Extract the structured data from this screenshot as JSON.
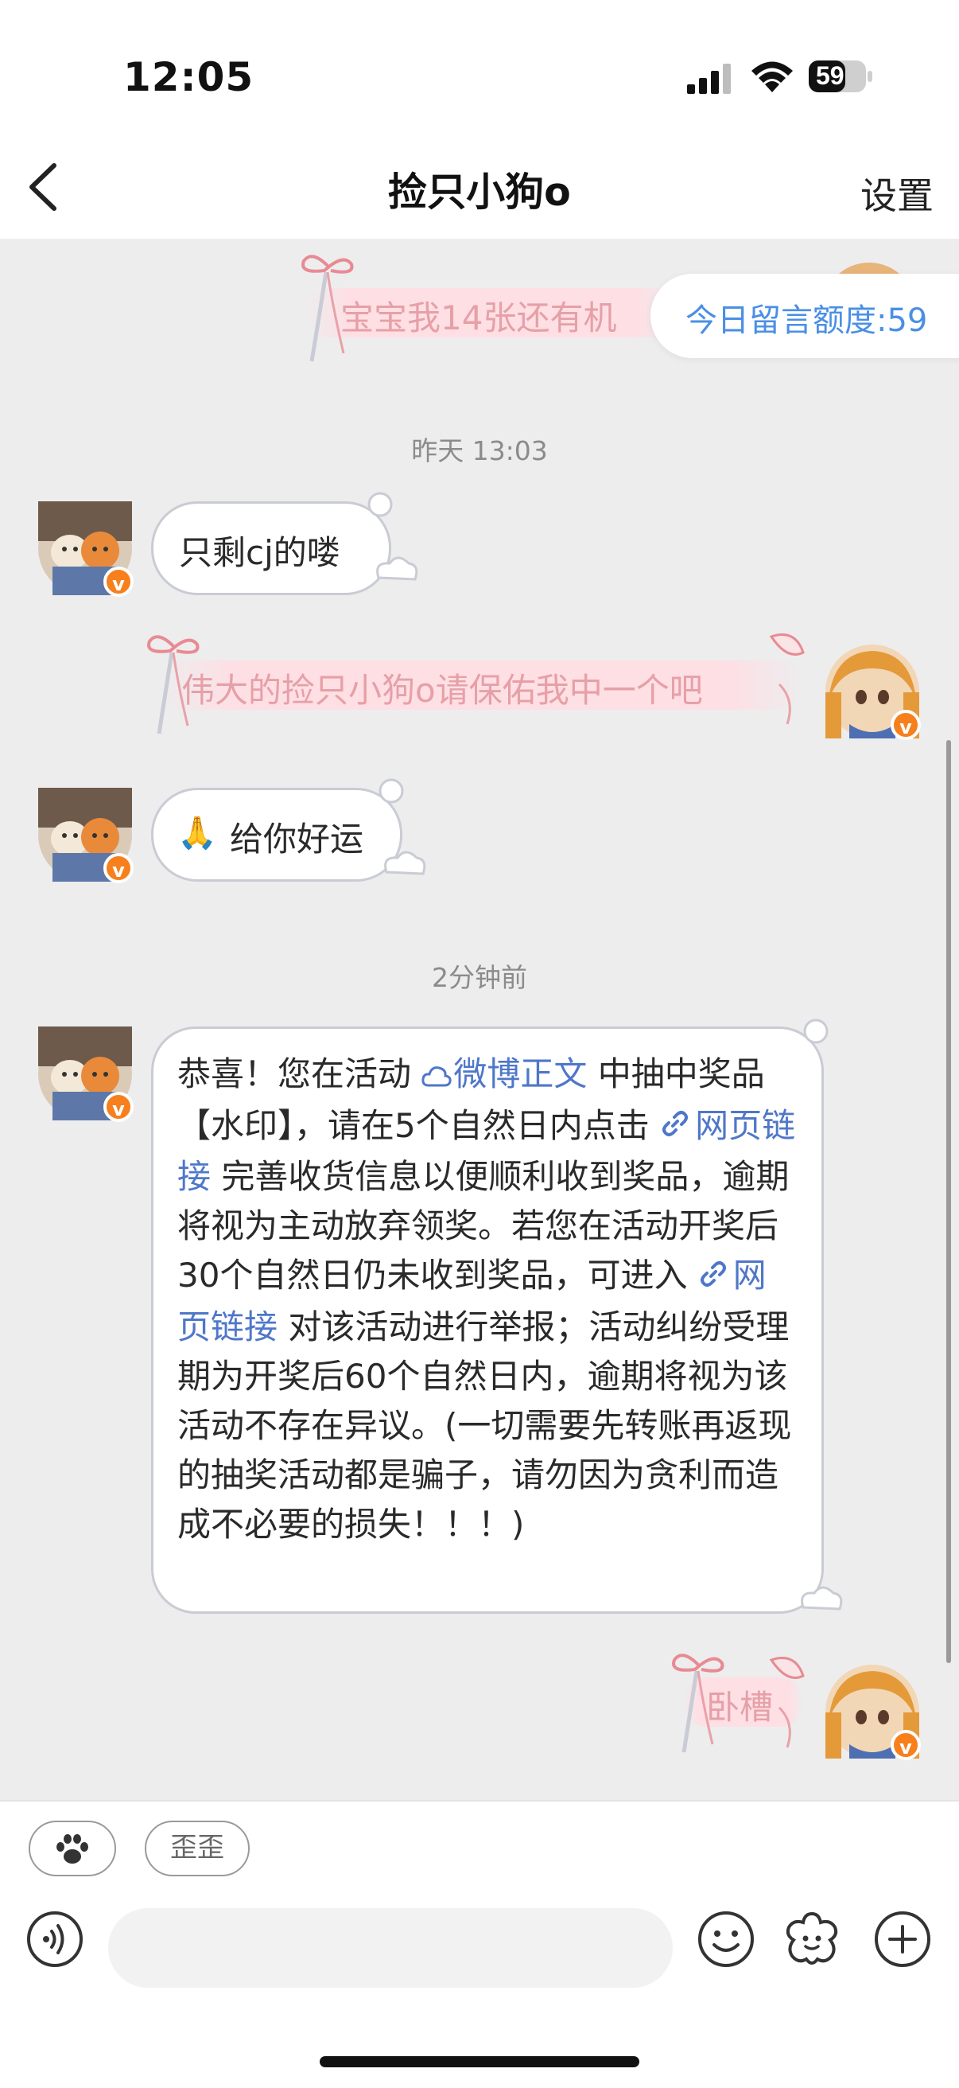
{
  "status_bar": {
    "time": "12:05",
    "battery": "59"
  },
  "nav": {
    "title": "捡只小狗o",
    "settings": "设置"
  },
  "quota": {
    "label": "今日留言额度:59"
  },
  "messages": {
    "out_1": "宝宝我14张还有机",
    "ts_1": "昨天 13:03",
    "in_1": "只剩cj的喽",
    "out_2": "伟大的捡只小狗o请保佑我中一个吧",
    "in_2": "给你好运",
    "ts_2": "2分钟前",
    "in_3": {
      "p1": "恭喜！您在活动 ",
      "link1": "微博正文",
      "p2": " 中抽中奖品【水印】，请在5个自然日内点击 ",
      "link2": "网页链接",
      "p3": " 完善收货信息以便顺利收到奖品，逾期将视为主动放弃领奖。若您在活动开奖后30个自然日仍未收到奖品，可进入 ",
      "link3": "网页链接",
      "p4": " 对该活动进行举报；活动纠纷受理期为开奖后60个自然日内，逾期将视为该活动不存在异议。(一切需要先转账再返现的抽奖活动都是骗子，请勿因为贪利而造成不必要的损失！！！)"
    },
    "out_3": "卧槽"
  },
  "badge_letter": "v",
  "quick_chips": {
    "chip_2": "歪歪"
  },
  "colors": {
    "link": "#4f77c9",
    "quota_text": "#4a8fe5",
    "badge": "#f77f1c",
    "pink_text": "#e6a0a7"
  }
}
